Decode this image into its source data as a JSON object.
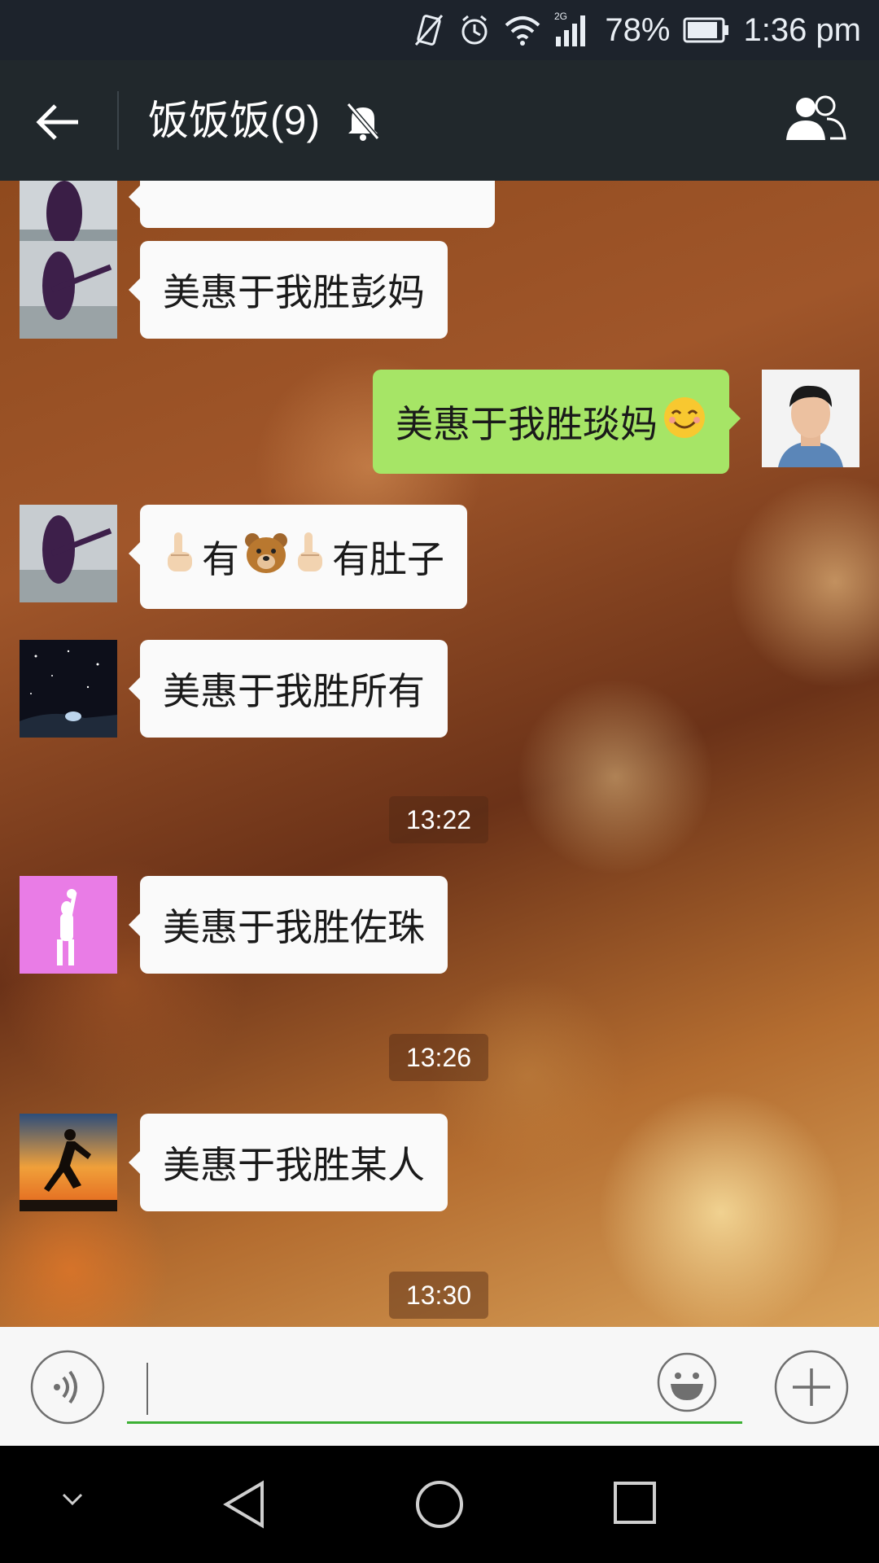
{
  "status_bar": {
    "battery_pct": "78%",
    "time": "1:36 pm",
    "network": "2G"
  },
  "header": {
    "title": "饭饭饭(9)"
  },
  "messages": [
    {
      "text": "美惠于我胜彭妈"
    },
    {
      "text": "美惠于我胜琰妈"
    },
    {
      "part1": "有",
      "part2": "有肚子"
    },
    {
      "text": "美惠于我胜所有"
    },
    {
      "text": "美惠于我胜佐珠"
    },
    {
      "text": "美惠于我胜某人"
    }
  ],
  "timestamps": [
    "13:22",
    "13:26",
    "13:30"
  ],
  "icons": {
    "back": "back-arrow-icon",
    "mute": "bell-off-icon",
    "members": "group-members-icon",
    "voice": "voice-input-icon",
    "emoji": "emoji-button-icon",
    "plus": "plus-button-icon"
  },
  "colors": {
    "header": "#21282c",
    "sent_bubble": "#a6e566",
    "received_bubble": "#fafafa",
    "input_underline": "#3cb034"
  }
}
